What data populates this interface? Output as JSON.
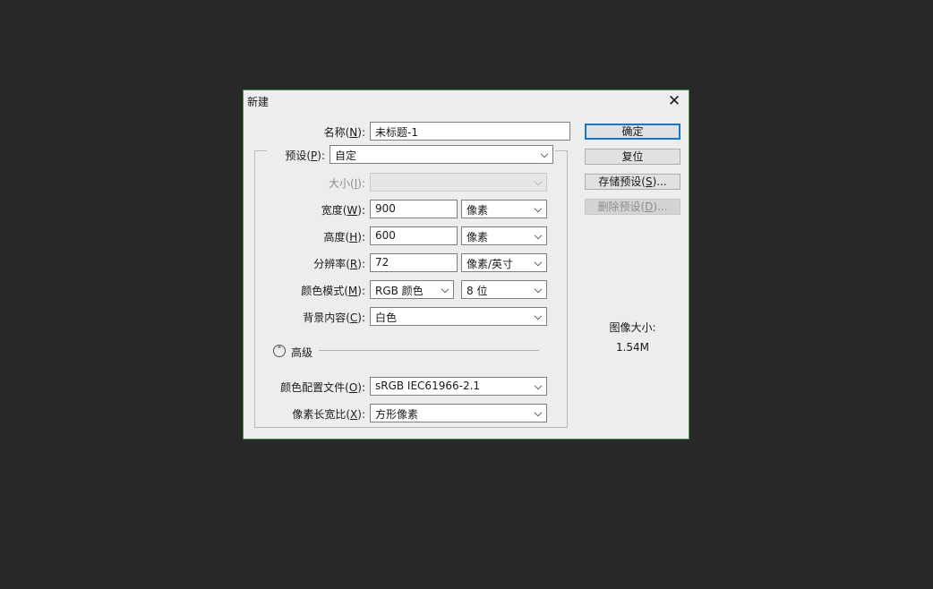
{
  "dialog": {
    "title": "新建",
    "close_glyph": "✕"
  },
  "form": {
    "name": {
      "label_pre": "名称(",
      "key": "N",
      "label_post": "):",
      "value": "未标题-1"
    },
    "preset": {
      "label_pre": "预设(",
      "key": "P",
      "label_post": "):",
      "value": "自定"
    },
    "size": {
      "label_pre": "大小(",
      "key": "I",
      "label_post": "):",
      "value": ""
    },
    "width": {
      "label_pre": "宽度(",
      "key": "W",
      "label_post": "):",
      "value": "900",
      "unit": "像素"
    },
    "height": {
      "label_pre": "高度(",
      "key": "H",
      "label_post": "):",
      "value": "600",
      "unit": "像素"
    },
    "resolution": {
      "label_pre": "分辨率(",
      "key": "R",
      "label_post": "):",
      "value": "72",
      "unit": "像素/英寸"
    },
    "color_mode": {
      "label_pre": "颜色模式(",
      "key": "M",
      "label_post": "):",
      "value": "RGB 颜色",
      "bits": "8 位"
    },
    "background": {
      "label_pre": "背景内容(",
      "key": "C",
      "label_post": "):",
      "value": "白色"
    },
    "advanced": {
      "label": "高级",
      "toggle_glyph": "⌃"
    },
    "color_profile": {
      "label_pre": "颜色配置文件(",
      "key": "O",
      "label_post": "):",
      "value": "sRGB IEC61966-2.1"
    },
    "pixel_aspect": {
      "label_pre": "像素长宽比(",
      "key": "X",
      "label_post": "):",
      "value": "方形像素"
    }
  },
  "buttons": {
    "ok": "确定",
    "reset": "复位",
    "save_preset_pre": "存储预设(",
    "save_preset_key": "S",
    "save_preset_post": ")...",
    "delete_preset_pre": "删除预设(",
    "delete_preset_key": "D",
    "delete_preset_post": ")..."
  },
  "image_size": {
    "label": "图像大小:",
    "value": "1.54M"
  },
  "colors": {
    "background": "#282828",
    "dialog": "#ededed",
    "dialog_border": "#3f8f3f",
    "primary_button_border": "#0f78d7"
  }
}
